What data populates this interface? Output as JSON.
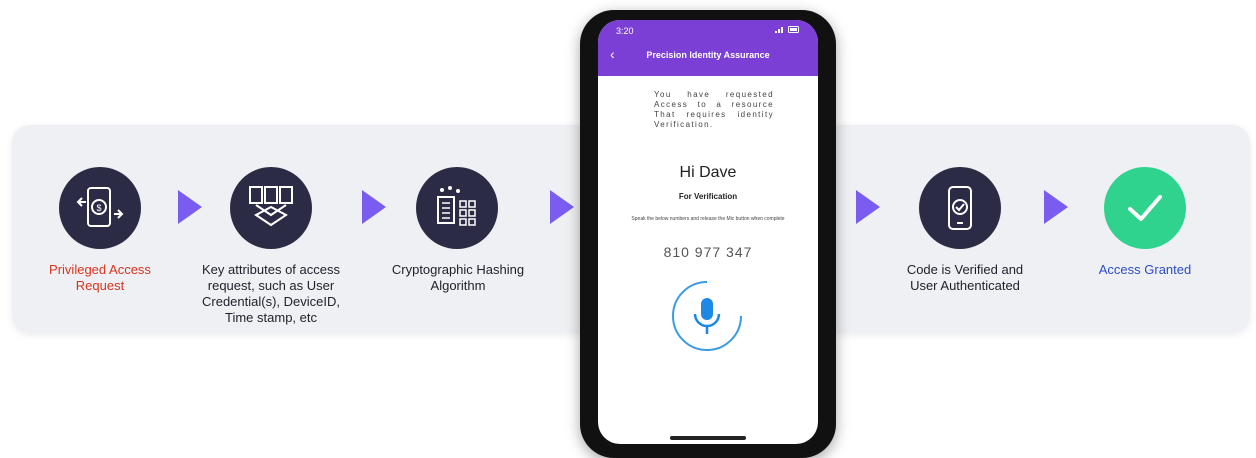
{
  "steps": [
    {
      "label": "Privileged Access Request",
      "icon": "mobile-swap-icon"
    },
    {
      "label": "Key attributes of access request, such as User Credential(s), DeviceID, Time stamp, etc",
      "icon": "documents-icon"
    },
    {
      "label": "Cryptographic Hashing Algorithm",
      "icon": "hashing-icon"
    },
    {
      "label": "Code is Verified and User Authenticated",
      "icon": "phone-check-icon"
    },
    {
      "label": "Access Granted",
      "icon": "checkmark-icon"
    }
  ],
  "phone": {
    "time": "3:20",
    "status_icons": "signal wifi battery",
    "app_title": "Precision Identity Assurance",
    "message": "You have requested Access to a resource That requires identity Verification.",
    "greeting": "Hi Dave",
    "subtitle": "For Verification",
    "instruction": "Speak the below numbers and release the Mic button when complete",
    "code": "810 977 347"
  },
  "colors": {
    "accent": "#7c3fd6",
    "arrow": "#7a5cf0",
    "circle": "#2c2b45",
    "success": "#2fd38e",
    "red": "#d8331f",
    "blue": "#2d4cc8"
  }
}
